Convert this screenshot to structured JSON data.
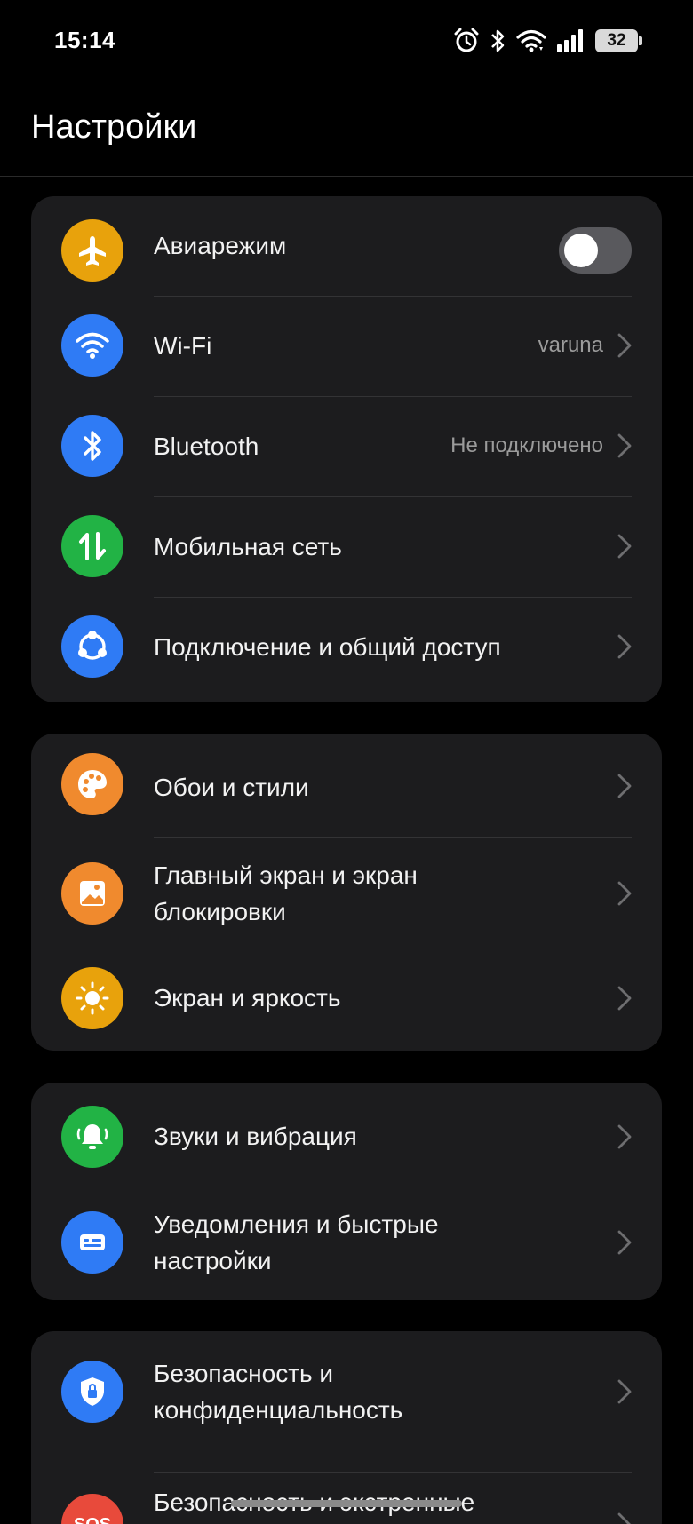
{
  "status_bar": {
    "time": "15:14",
    "battery": "32"
  },
  "header": {
    "title": "Настройки"
  },
  "groups": [
    {
      "items": [
        {
          "label": "Авиарежим",
          "icon": "airplane-icon",
          "color": "#e8a20c",
          "toggle": false
        },
        {
          "label": "Wi-Fi",
          "value": "varuna",
          "icon": "wifi-icon",
          "color": "#2f7bf5"
        },
        {
          "label": "Bluetooth",
          "value": "Не подключено",
          "icon": "bluetooth-icon",
          "color": "#2f7bf5"
        },
        {
          "label": "Мобильная сеть",
          "icon": "mobile-data-icon",
          "color": "#22b345"
        },
        {
          "label": "Подключение и общий доступ",
          "icon": "share-icon",
          "color": "#2f7bf5"
        }
      ]
    },
    {
      "items": [
        {
          "label": "Обои и стили",
          "icon": "palette-icon",
          "color": "#f08a2e"
        },
        {
          "label": "Главный экран и экран блокировки",
          "icon": "picture-icon",
          "color": "#f08a2e"
        },
        {
          "label": "Экран и яркость",
          "icon": "sun-icon",
          "color": "#e8a20c"
        }
      ]
    },
    {
      "items": [
        {
          "label": "Звуки и вибрация",
          "icon": "bell-icon",
          "color": "#22b345"
        },
        {
          "label": "Уведомления и быстрые настройки",
          "icon": "notification-card-icon",
          "color": "#2f7bf5"
        }
      ]
    },
    {
      "items": [
        {
          "label": "Безопасность и конфиденциальность",
          "icon": "shield-lock-icon",
          "color": "#2f7bf5"
        },
        {
          "label": "Безопасность и экстренные случаи",
          "icon": "sos-icon",
          "color": "#e84a3b",
          "icon_text": "SOS"
        }
      ]
    }
  ]
}
